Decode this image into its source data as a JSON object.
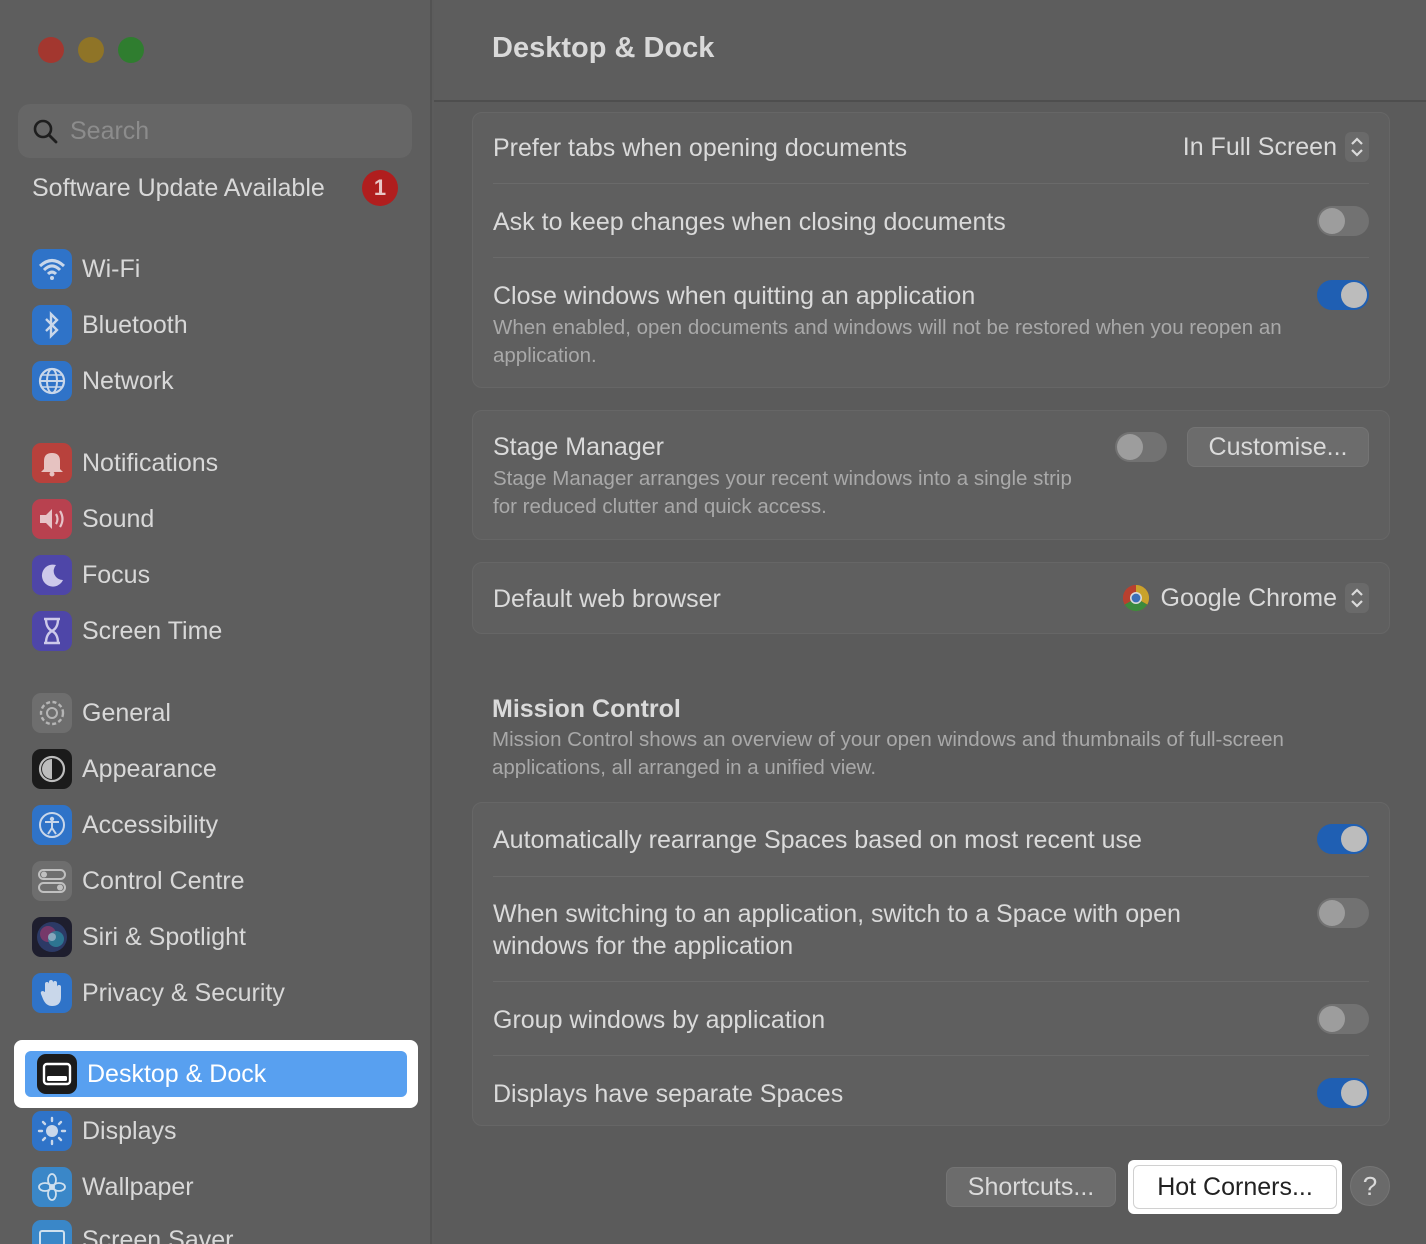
{
  "sidebar": {
    "search_placeholder": "Search",
    "update_label": "Software Update Available",
    "update_badge": "1",
    "items": [
      {
        "key": "wifi",
        "label": "Wi-Fi",
        "icon": "wifi-icon",
        "color": "#2f73c8"
      },
      {
        "key": "bluetooth",
        "label": "Bluetooth",
        "icon": "bluetooth-icon",
        "color": "#2f73c8"
      },
      {
        "key": "network",
        "label": "Network",
        "icon": "globe-icon",
        "color": "#2f73c8"
      },
      {
        "key": "notifications",
        "label": "Notifications",
        "icon": "bell-icon",
        "color": "#b8413c"
      },
      {
        "key": "sound",
        "label": "Sound",
        "icon": "speaker-icon",
        "color": "#b8414f"
      },
      {
        "key": "focus",
        "label": "Focus",
        "icon": "moon-icon",
        "color": "#4e46a8"
      },
      {
        "key": "screen-time",
        "label": "Screen Time",
        "icon": "hourglass-icon",
        "color": "#4e46a8"
      },
      {
        "key": "general",
        "label": "General",
        "icon": "gear-icon",
        "color": "#6e6e6e"
      },
      {
        "key": "appearance",
        "label": "Appearance",
        "icon": "appearance-icon",
        "color": "#1b1b1b"
      },
      {
        "key": "accessibility",
        "label": "Accessibility",
        "icon": "accessibility-icon",
        "color": "#2f73c8"
      },
      {
        "key": "control-centre",
        "label": "Control Centre",
        "icon": "switches-icon",
        "color": "#6e6e6e"
      },
      {
        "key": "siri",
        "label": "Siri & Spotlight",
        "icon": "siri-icon",
        "color": "#2a2a4a"
      },
      {
        "key": "privacy",
        "label": "Privacy & Security",
        "icon": "hand-icon",
        "color": "#2f73c8"
      },
      {
        "key": "desktop-dock",
        "label": "Desktop & Dock",
        "icon": "dock-icon",
        "color": "#1b1b1b"
      },
      {
        "key": "displays",
        "label": "Displays",
        "icon": "sun-icon",
        "color": "#2f73c8"
      },
      {
        "key": "wallpaper",
        "label": "Wallpaper",
        "icon": "flower-icon",
        "color": "#3a87c8"
      },
      {
        "key": "screen-saver",
        "label": "Screen Saver",
        "icon": "screensaver-icon",
        "color": "#3a87c8"
      }
    ],
    "selected": "desktop-dock"
  },
  "main": {
    "title": "Desktop & Dock",
    "prefer_tabs": {
      "label": "Prefer tabs when opening documents",
      "value": "In Full Screen"
    },
    "ask_keep": {
      "label": "Ask to keep changes when closing documents",
      "on": false
    },
    "close_windows": {
      "label": "Close windows when quitting an application",
      "desc": "When enabled, open documents and windows will not be restored when you reopen an application.",
      "on": true
    },
    "stage_manager": {
      "label": "Stage Manager",
      "desc": "Stage Manager arranges your recent windows into a single strip for reduced clutter and quick access.",
      "on": false,
      "button": "Customise..."
    },
    "browser": {
      "label": "Default web browser",
      "value": "Google Chrome"
    },
    "mission_control": {
      "title": "Mission Control",
      "desc": "Mission Control shows an overview of your open windows and thumbnails of full-screen applications, all arranged in a unified view.",
      "rearrange": {
        "label": "Automatically rearrange Spaces based on most recent use",
        "on": true
      },
      "switch_space": {
        "label": "When switching to an application, switch to a Space with open windows for the application",
        "on": false
      },
      "group_windows": {
        "label": "Group windows by application",
        "on": false
      },
      "separate_spaces": {
        "label": "Displays have separate Spaces",
        "on": true
      }
    },
    "footer": {
      "shortcuts": "Shortcuts...",
      "hot_corners": "Hot Corners...",
      "help": "?"
    }
  }
}
